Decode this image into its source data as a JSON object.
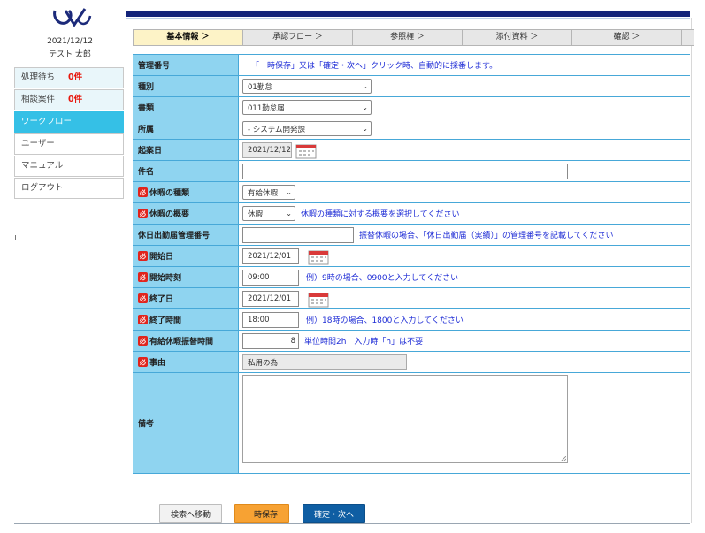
{
  "sidebar": {
    "date": "2021/12/12",
    "user": "テスト 太郎",
    "items": [
      {
        "label": "処理待ち",
        "count": "0件"
      },
      {
        "label": "相談案件",
        "count": "0件"
      },
      {
        "label": "ワークフロー"
      },
      {
        "label": "ユーザー"
      },
      {
        "label": "マニュアル"
      },
      {
        "label": "ログアウト"
      }
    ]
  },
  "tabs": [
    "基本情報 ＞",
    "承認フロー ＞",
    "参照権 ＞",
    "添付資料 ＞",
    "確認 ＞"
  ],
  "form": {
    "kanri": {
      "label": "管理番号",
      "note": "「一時保存」又は「確定・次へ」クリック時、自動的に採番します。"
    },
    "shubetsu": {
      "label": "種別",
      "value": "01勤怠"
    },
    "shorui": {
      "label": "書類",
      "value": "011勤怠届"
    },
    "shozoku": {
      "label": "所属",
      "value": "- システム開発課"
    },
    "kian": {
      "label": "起案日",
      "value": "2021/12/12"
    },
    "kenmei": {
      "label": "件名",
      "value": ""
    },
    "kyuka_shurui": {
      "label": "休暇の種類",
      "value": "有給休暇"
    },
    "kyuka_gaiyo": {
      "label": "休暇の概要",
      "value": "休暇",
      "note": "休暇の種類に対する概要を選択してください"
    },
    "kyujitsu": {
      "label": "休日出勤届管理番号",
      "value": "",
      "note": "振替休暇の場合、「休日出勤届（実績）」の管理番号を記載してください"
    },
    "kaishi_bi": {
      "label": "開始日",
      "value": "2021/12/01"
    },
    "kaishi_jikoku": {
      "label": "開始時刻",
      "value": "09:00",
      "note": "例）9時の場合、0900と入力してください"
    },
    "shuryo_bi": {
      "label": "終了日",
      "value": "2021/12/01"
    },
    "shuryo_jikan": {
      "label": "終了時間",
      "value": "18:00",
      "note": "例）18時の場合、1800と入力してください"
    },
    "yukyu": {
      "label": "有給休暇振替時間",
      "value": "8",
      "note": "単位時間2h　入力時「h」は不要"
    },
    "jiyu": {
      "label": "事由",
      "value": "私用の為"
    },
    "biko": {
      "label": "備考",
      "value": ""
    },
    "required_mark": "必"
  },
  "buttons": {
    "search": "検索へ移動",
    "save": "一時保存",
    "next": "確定・次へ"
  },
  "colors": {
    "header_bar": "#13247a",
    "label_bg": "#8fd4f0",
    "active_menu": "#35c0e6",
    "required": "#e0241d",
    "note_text": "#1f2dd6",
    "save_button": "#f7a233",
    "next_button": "#0f5ea3"
  }
}
